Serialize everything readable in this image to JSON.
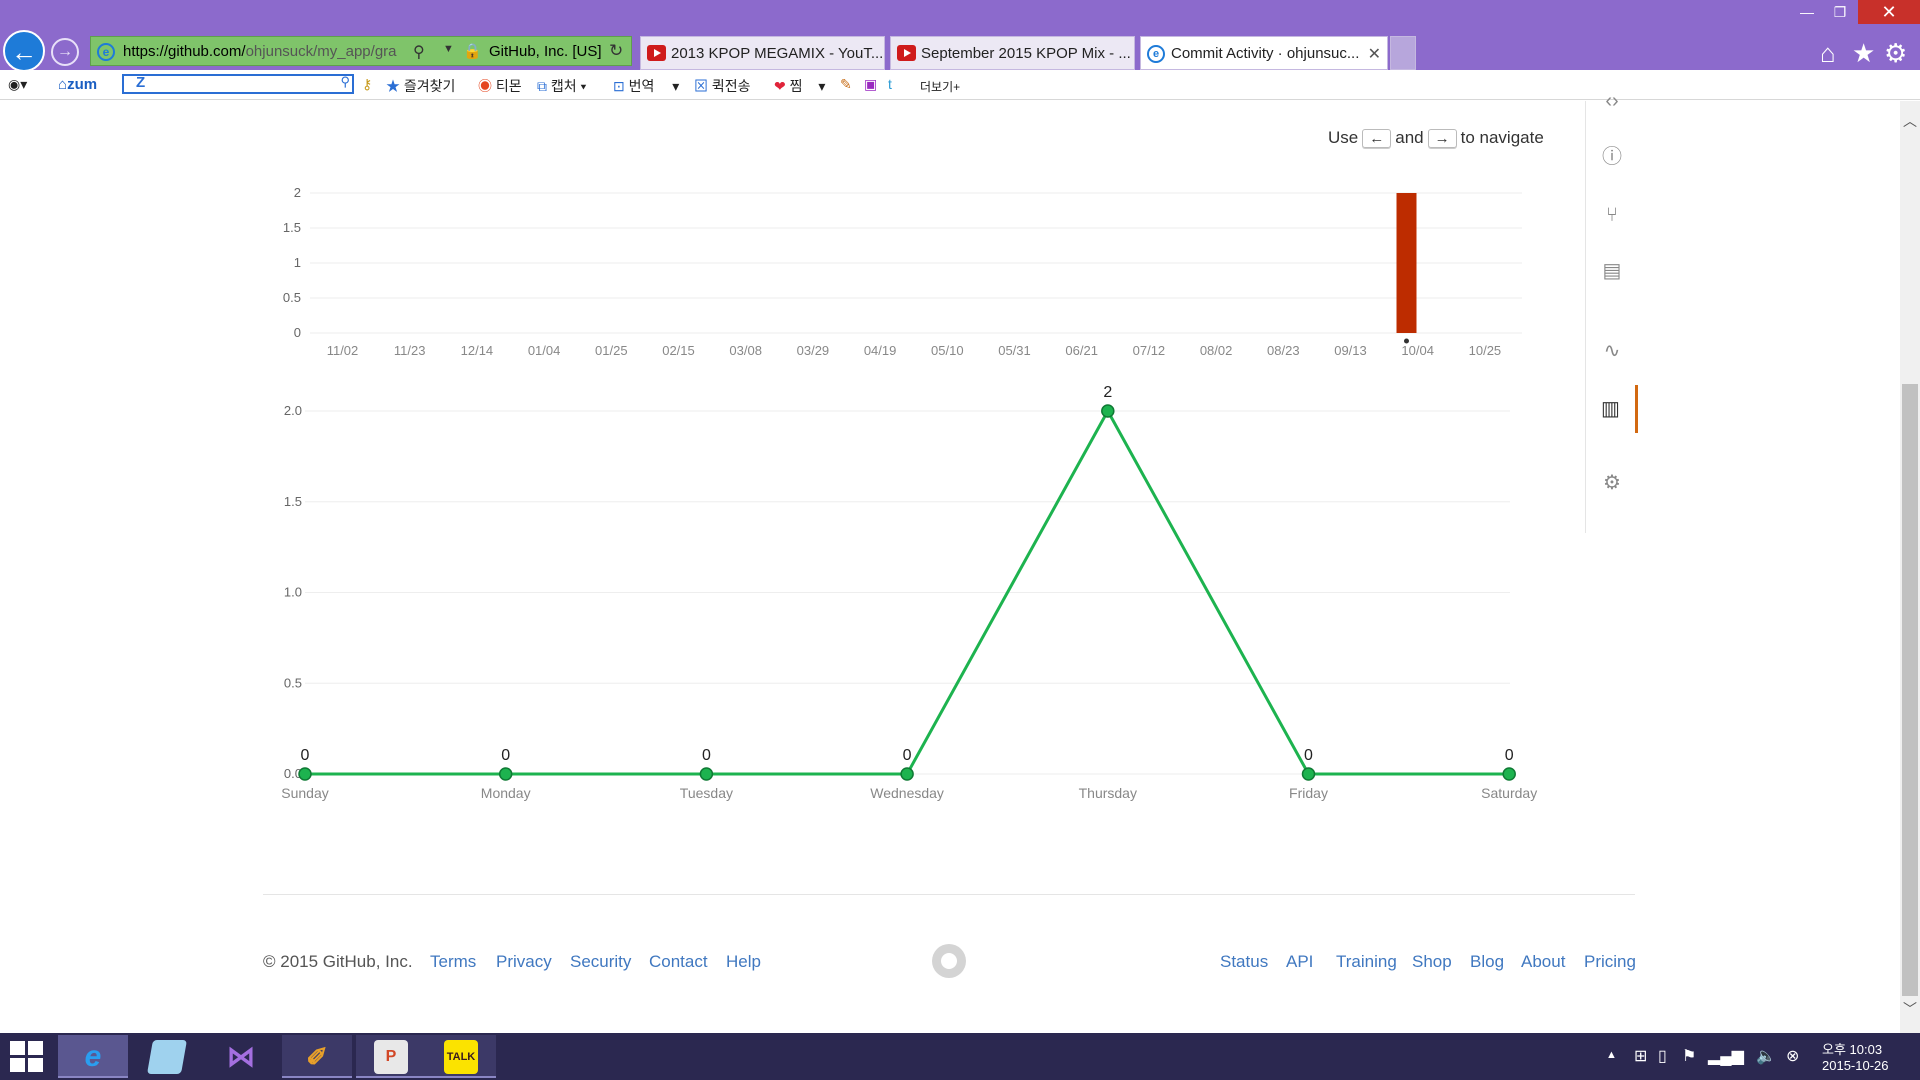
{
  "window": {
    "minimize": "—",
    "maximize": "❐",
    "close": "✕"
  },
  "address_bar": {
    "url_host": "https://github.com/",
    "url_path": "ohjunsuck/my_app/gra",
    "site_identity": "GitHub, Inc. [US]"
  },
  "tabs": [
    {
      "label": "2013 KPOP MEGAMIX - YouT...",
      "icon": "youtube-icon"
    },
    {
      "label": "September 2015 KPOP Mix - ...",
      "icon": "youtube-icon"
    },
    {
      "label": "Commit Activity · ohjunsuc...",
      "icon": "ie-icon",
      "active": true
    }
  ],
  "toolbar": {
    "zum": "zum",
    "items": [
      "즐겨찾기",
      "티몬",
      "캡처",
      "번역",
      "퀵전송",
      "찜",
      "더보기+"
    ]
  },
  "page": {
    "nav_hint": {
      "use": "Use",
      "left_key": "←",
      "and": "and",
      "right_key": "→",
      "to_navigate": "to navigate"
    }
  },
  "chart_data": [
    {
      "type": "bar",
      "title": "",
      "categories": [
        "11/02",
        "11/23",
        "12/14",
        "01/04",
        "01/25",
        "02/15",
        "03/08",
        "03/29",
        "04/19",
        "05/10",
        "05/31",
        "06/21",
        "07/12",
        "08/02",
        "08/23",
        "09/13",
        "10/04",
        "10/25"
      ],
      "weekly_x_tick_labels_note": "",
      "bars": [
        {
          "week_after": "09/13",
          "value": 2
        }
      ],
      "y_ticks": [
        "0",
        "0.5",
        "1",
        "1.5",
        "2"
      ],
      "ylim": [
        0,
        2
      ],
      "color": "#bd2c00",
      "grid": true
    },
    {
      "type": "line",
      "title": "",
      "categories": [
        "Sunday",
        "Monday",
        "Tuesday",
        "Wednesday",
        "Thursday",
        "Friday",
        "Saturday"
      ],
      "values": [
        0,
        0,
        0,
        0,
        2,
        0,
        0
      ],
      "data_labels": [
        "0",
        "0",
        "0",
        "0",
        "2",
        "0",
        "0"
      ],
      "y_ticks": [
        "0.0",
        "0.5",
        "1.0",
        "1.5",
        "2.0"
      ],
      "ylim": [
        0,
        2
      ],
      "color": "#1db34f",
      "grid": true
    }
  ],
  "footer": {
    "copyright": "© 2015 GitHub, Inc.",
    "left_links": [
      "Terms",
      "Privacy",
      "Security",
      "Contact",
      "Help"
    ],
    "right_links": [
      "Status",
      "API",
      "Training",
      "Shop",
      "Blog",
      "About",
      "Pricing"
    ]
  },
  "taskbar": {
    "clock_time": "오후 10:03",
    "clock_date": "2015-10-26",
    "kakao_label": "TALK"
  }
}
